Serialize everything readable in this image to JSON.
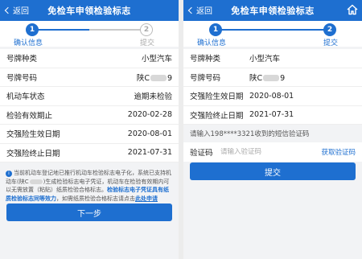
{
  "left": {
    "nav": {
      "back": "返回",
      "title": "免检车申领检验标志"
    },
    "steps": {
      "step1_num": "1",
      "step1_label": "确认信息",
      "step2_num": "2",
      "step2_label": "提交"
    },
    "rows": [
      {
        "key": "号牌种类",
        "value": "小型汽车"
      },
      {
        "key": "号牌号码",
        "value_prefix": "陕C",
        "value_suffix": "9"
      },
      {
        "key": "机动车状态",
        "value": "逾期未检验"
      },
      {
        "key": "检验有效期止",
        "value": "2020-02-28"
      },
      {
        "key": "交强险生效日期",
        "value": "2020-08-01"
      },
      {
        "key": "交强险终止日期",
        "value": "2021-07-31"
      }
    ],
    "notice": {
      "part1": "当前机动车登记地已推行机动车检验标志电子化，系统已支持机动车(陕C",
      "part2": ")生成检验标志电子凭证，机动车在检验有效期内可以无需放置（粘贴）纸质检验合格标志。",
      "highlight": "检验标志电子凭证具有纸质检验标志同等效力",
      "part3": "，如需纸质检验合格标志请点击",
      "link": "此处申请"
    },
    "button": "下一步"
  },
  "right": {
    "nav": {
      "back": "返回",
      "title": "免检车申领检验标志"
    },
    "steps": {
      "step1_num": "1",
      "step1_label": "确认信息",
      "step2_num": "2",
      "step2_label": "提交"
    },
    "rows": [
      {
        "key": "号牌种类",
        "value": "小型汽车"
      },
      {
        "key": "号牌号码",
        "value_prefix": "陕C",
        "value_suffix": "9"
      },
      {
        "key": "交强险生效日期",
        "value": "2020-08-01"
      },
      {
        "key": "交强险终止日期",
        "value": "2021-07-31"
      }
    ],
    "sms_hint": "请输入198****3321收到的短信验证码",
    "code": {
      "label": "验证码",
      "placeholder": "请输入验证码",
      "get": "获取验证码"
    },
    "button": "提交"
  },
  "colors": {
    "primary": "#1e6fd0",
    "nav": "#1e6fd0"
  }
}
